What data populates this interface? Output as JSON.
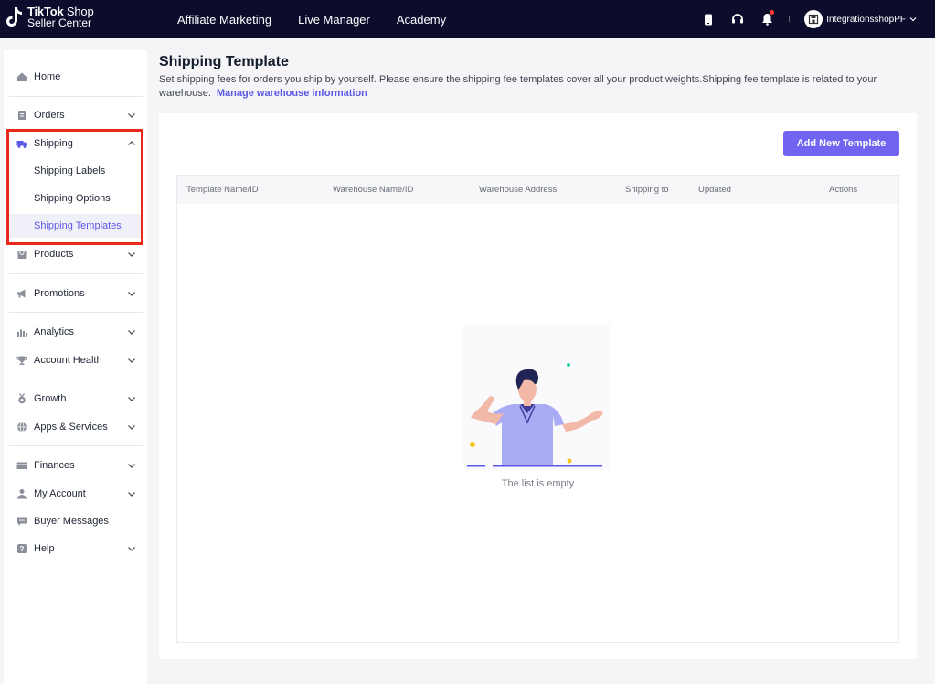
{
  "brand": {
    "line1_bold": "TikTok",
    "line1_thin": " Shop",
    "line2": "Seller Center"
  },
  "topnav": [
    "Affiliate Marketing",
    "Live Manager",
    "Academy"
  ],
  "top_icons": [
    "phone-icon",
    "headset-icon",
    "bell-icon"
  ],
  "shop": {
    "name": "IntegrationsshopPF",
    "icon": "store-icon"
  },
  "sidebar": {
    "items": [
      {
        "label": "Home",
        "icon": "home-icon"
      },
      {
        "label": "Orders",
        "icon": "orders-icon"
      },
      {
        "label": "Shipping",
        "icon": "truck-icon",
        "expanded": true,
        "children": [
          "Shipping Labels",
          "Shipping Options",
          "Shipping Templates"
        ],
        "active_child": "Shipping Templates"
      },
      {
        "label": "Products",
        "icon": "products-icon"
      },
      {
        "label": "Promotions",
        "icon": "megaphone-icon"
      },
      {
        "label": "Analytics",
        "icon": "chart-icon"
      },
      {
        "label": "Account Health",
        "icon": "trophy-icon"
      },
      {
        "label": "Growth",
        "icon": "medal-icon"
      },
      {
        "label": "Apps & Services",
        "icon": "globe-icon"
      },
      {
        "label": "Finances",
        "icon": "card-icon"
      },
      {
        "label": "My Account",
        "icon": "user-icon"
      },
      {
        "label": "Buyer Messages",
        "icon": "message-icon"
      },
      {
        "label": "Help",
        "icon": "help-icon"
      }
    ]
  },
  "main": {
    "title": "Shipping Template",
    "description": "Set shipping fees for orders you ship by yourself. Please ensure the shipping fee templates cover all your product weights.Shipping fee template is related to your warehouse.",
    "manage_link": "Manage warehouse information",
    "add_button": "Add New Template",
    "table": {
      "columns": [
        "Template Name/ID",
        "Warehouse Name/ID",
        "Warehouse Address",
        "Shipping to",
        "Updated",
        "Actions"
      ],
      "rows": [],
      "empty_text": "The list is empty"
    }
  },
  "colors": {
    "accent": "#5b58e6",
    "button": "#7064f0",
    "topbar": "#0c0c2c",
    "highlight_box": "#e8281a"
  }
}
